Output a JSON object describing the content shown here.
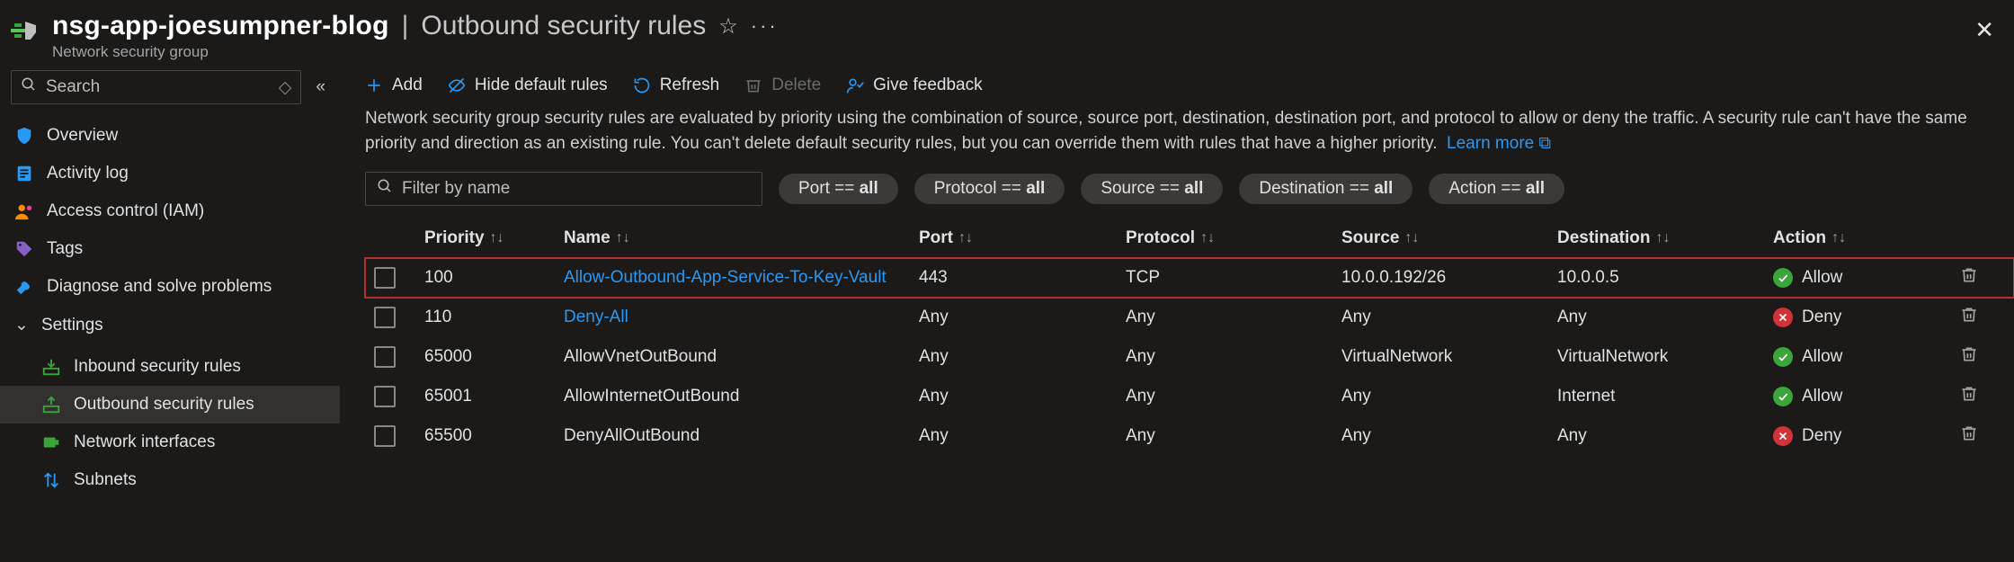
{
  "header": {
    "resource_name": "nsg-app-joesumpner-blog",
    "page_title": "Outbound security rules",
    "resource_type": "Network security group"
  },
  "search": {
    "placeholder": "Search"
  },
  "sidebar": {
    "items": [
      {
        "label": "Overview",
        "icon": "shield"
      },
      {
        "label": "Activity log",
        "icon": "log"
      },
      {
        "label": "Access control (IAM)",
        "icon": "people"
      },
      {
        "label": "Tags",
        "icon": "tag"
      },
      {
        "label": "Diagnose and solve problems",
        "icon": "wrench"
      }
    ],
    "settings_label": "Settings",
    "settings": [
      {
        "label": "Inbound security rules",
        "icon": "inbound",
        "selected": false
      },
      {
        "label": "Outbound security rules",
        "icon": "outbound",
        "selected": true
      },
      {
        "label": "Network interfaces",
        "icon": "nic",
        "selected": false
      },
      {
        "label": "Subnets",
        "icon": "subnet",
        "selected": false
      }
    ]
  },
  "toolbar": {
    "add": "Add",
    "hide": "Hide default rules",
    "refresh": "Refresh",
    "delete": "Delete",
    "feedback": "Give feedback"
  },
  "description": {
    "text": "Network security group security rules are evaluated by priority using the combination of source, source port, destination, destination port, and protocol to allow or deny the traffic. A security rule can't have the same priority and direction as an existing rule. You can't delete default security rules, but you can override them with rules that have a higher priority.",
    "learn_more": "Learn more"
  },
  "filters": {
    "name_placeholder": "Filter by name",
    "pills": {
      "port": {
        "label": "Port == ",
        "value": "all"
      },
      "protocol": {
        "label": "Protocol == ",
        "value": "all"
      },
      "source": {
        "label": "Source == ",
        "value": "all"
      },
      "destination": {
        "label": "Destination == ",
        "value": "all"
      },
      "action": {
        "label": "Action == ",
        "value": "all"
      }
    }
  },
  "columns": {
    "priority": "Priority",
    "name": "Name",
    "port": "Port",
    "protocol": "Protocol",
    "source": "Source",
    "destination": "Destination",
    "action": "Action"
  },
  "rows": [
    {
      "priority": "100",
      "name": "Allow-Outbound-App-Service-To-Key-Vault",
      "port": "443",
      "protocol": "TCP",
      "source": "10.0.0.192/26",
      "destination": "10.0.0.5",
      "action": "Allow",
      "action_kind": "allow",
      "link": true,
      "highlight": true
    },
    {
      "priority": "110",
      "name": "Deny-All",
      "port": "Any",
      "protocol": "Any",
      "source": "Any",
      "destination": "Any",
      "action": "Deny",
      "action_kind": "deny",
      "link": true,
      "highlight": false
    },
    {
      "priority": "65000",
      "name": "AllowVnetOutBound",
      "port": "Any",
      "protocol": "Any",
      "source": "VirtualNetwork",
      "destination": "VirtualNetwork",
      "action": "Allow",
      "action_kind": "allow",
      "link": false,
      "highlight": false
    },
    {
      "priority": "65001",
      "name": "AllowInternetOutBound",
      "port": "Any",
      "protocol": "Any",
      "source": "Any",
      "destination": "Internet",
      "action": "Allow",
      "action_kind": "allow",
      "link": false,
      "highlight": false
    },
    {
      "priority": "65500",
      "name": "DenyAllOutBound",
      "port": "Any",
      "protocol": "Any",
      "source": "Any",
      "destination": "Any",
      "action": "Deny",
      "action_kind": "deny",
      "link": false,
      "highlight": false
    }
  ]
}
